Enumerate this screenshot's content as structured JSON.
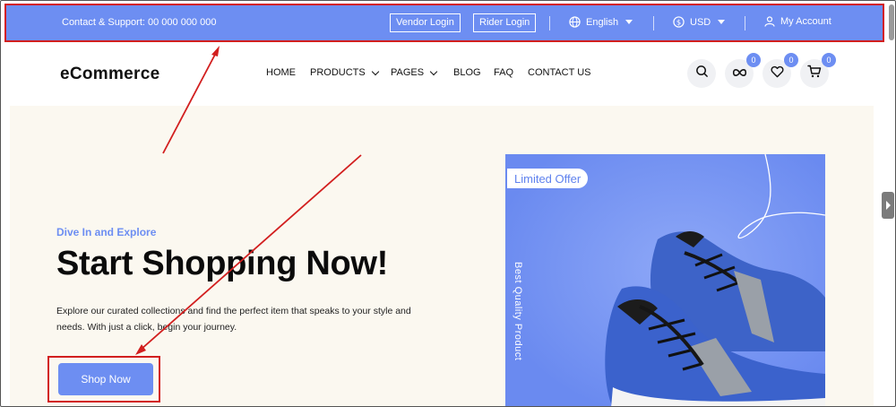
{
  "topbar": {
    "contact": "Contact & Support: 00 000 000 000",
    "vendor_login": "Vendor Login",
    "rider_login": "Rider Login",
    "language": "English",
    "currency": "USD",
    "account": "My Account",
    "bg_color": "#6d8ef2"
  },
  "header": {
    "logo": "eCommerce",
    "nav": {
      "home": "HOME",
      "products": "PRODUCTS",
      "pages": "PAGES",
      "blog": "BLOG",
      "faq": "FAQ",
      "contact": "CONTACT US"
    },
    "badges": {
      "compare": "0",
      "wishlist": "0",
      "cart": "0"
    }
  },
  "hero": {
    "kicker": "Dive In and Explore",
    "headline": "Start Shopping Now!",
    "description": "Explore our curated collections and find the perfect item that speaks to your style and needs. With just a click, begin your journey.",
    "cta": "Shop Now",
    "promo_tag": "Limited Offer",
    "promo_vertical": "Best Quality Product",
    "accent_color": "#6d8ef2",
    "bg_color": "#fbf8f0"
  },
  "annotation": {
    "highlight_color": "#d21f1f"
  }
}
